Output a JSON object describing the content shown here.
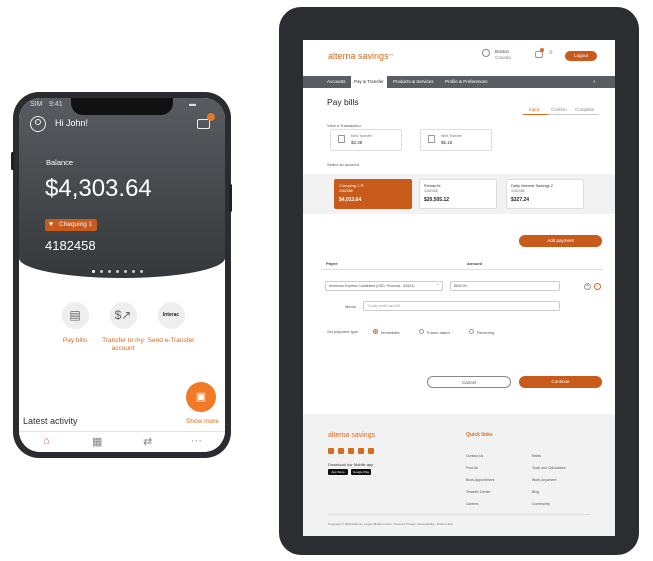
{
  "phone": {
    "status_time": "9:41",
    "carrier": "SIM",
    "greeting": "Hi John!",
    "balance_label": "Balance",
    "balance": "$4,303.64",
    "account_name": "Chequing 1",
    "account_number": "4182458",
    "quick_actions": [
      {
        "label": "Pay bills",
        "icon": "bill-icon"
      },
      {
        "label": "Transfer to my account",
        "icon": "transfer-icon"
      },
      {
        "label": "Send e-Transfer",
        "icon": "interac-icon"
      }
    ],
    "interac_text": "Interac",
    "latest_activity": "Latest activity",
    "show_more": "Show more",
    "tabs": [
      "home-icon",
      "accounts-icon",
      "transfer-icon",
      "more-icon"
    ],
    "accent": "#d66a1e"
  },
  "tablet": {
    "logo_light": "alterna",
    "logo_bold": "savings",
    "user_name": "Boston",
    "user_sub": "Canada",
    "logout": "Logout",
    "nav": [
      "Accounts",
      "Pay & Transfer",
      "Products & Services",
      "Profile & Preferences"
    ],
    "title": "Pay bills",
    "steps": [
      "Input",
      "Confirm",
      "Complete"
    ],
    "recent_label": "View a Transaction",
    "recent": [
      {
        "label": "Next Transfer",
        "value": "$2.38"
      },
      {
        "label": "Next Transfer",
        "value": "$5.15"
      }
    ],
    "select_account": "Select an account",
    "accounts": [
      {
        "name": "Chequing 1 ®",
        "number": "4182458",
        "balance": "$4,013.64"
      },
      {
        "name": "Richard's",
        "number": "4182458",
        "balance": "$20,505.12"
      },
      {
        "name": "Daily Interest Savings 2",
        "number": "4182458",
        "balance": "$327.24"
      }
    ],
    "add_payment": "Add payment",
    "payee_header": "Payee",
    "amount_header": "Amount",
    "payee_value": "American Express Cardlinked (USD, Products - $1521)",
    "amount_value": "$540.00",
    "memo_label": "Memo",
    "memo_placeholder": "To pay credit card bill",
    "payment_type_label": "Set payment type",
    "payment_types": [
      "Immediate",
      "Future dated",
      "Recurring"
    ],
    "cancel": "Cancel",
    "continue": "Continue",
    "footer": {
      "download": "Download our Mobile app",
      "app_store": "App Store",
      "google_play": "Google Play",
      "quick_links_title": "Quick links",
      "links_col1": [
        "Contact Us",
        "Find Us",
        "Book Appointment",
        "Tenant's Center",
        "Careers"
      ],
      "links_col2": [
        "Rates",
        "Tools and Calculators",
        "Work Anywhere",
        "Blog",
        "Community"
      ],
      "copyright": "Copyright © 2020 Alterna  |  Legal  |  Media Centre  |  Security Privacy  |  Accessibility  |  Online Help"
    }
  }
}
